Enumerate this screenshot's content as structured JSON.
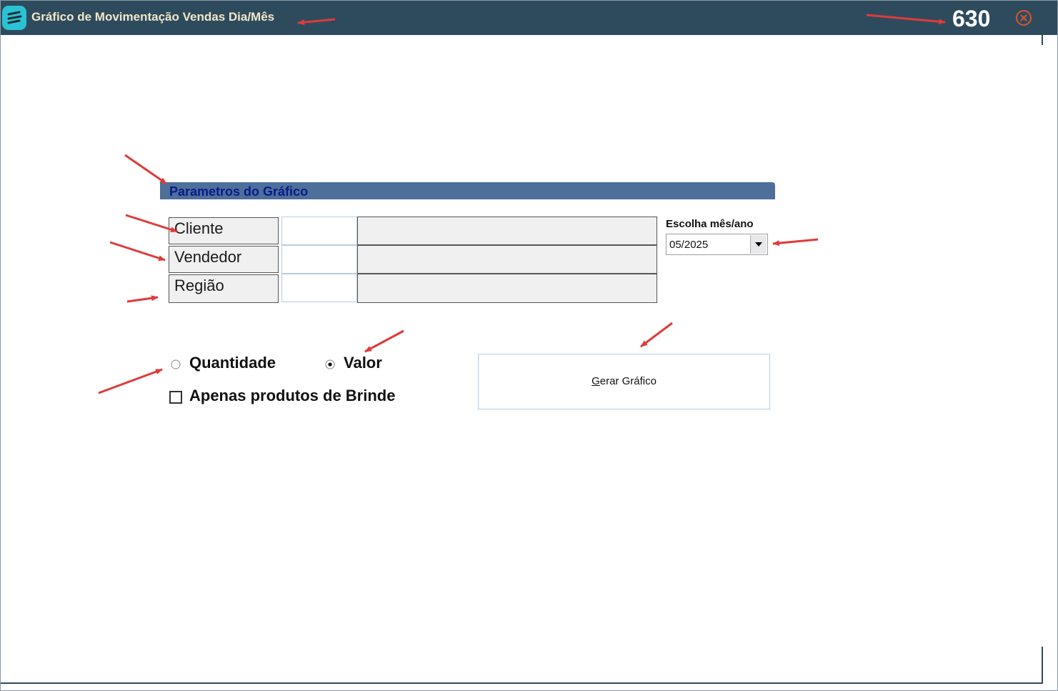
{
  "window": {
    "title": "Gráfico de Movimentação Vendas Dia/Mês",
    "code": "630",
    "icons": {
      "app": "app-logo-icon",
      "close": "close-icon"
    },
    "colors": {
      "titlebar": "#2e4b5e",
      "title_text": "#f1e6c8",
      "close": "#d9542c",
      "logo": "#29c3d4"
    }
  },
  "params": {
    "header": "Parametros do Gráfico",
    "header_color": "#4d6f9a",
    "fields": [
      {
        "label": "Cliente",
        "code": "",
        "description": ""
      },
      {
        "label": "Vendedor",
        "code": "",
        "description": ""
      },
      {
        "label": "Região",
        "code": "",
        "description": ""
      }
    ]
  },
  "period": {
    "label": "Escolha mês/ano",
    "selected": "05/2025"
  },
  "options": {
    "quantidade": {
      "label": "Quantidade",
      "checked": false
    },
    "valor": {
      "label": "Valor",
      "checked": true
    },
    "brinde": {
      "label": "Apenas produtos de Brinde",
      "checked": false
    }
  },
  "actions": {
    "gerar_first": "G",
    "gerar_rest": "erar Gráfico"
  },
  "annotation_color": "#e03a3a"
}
